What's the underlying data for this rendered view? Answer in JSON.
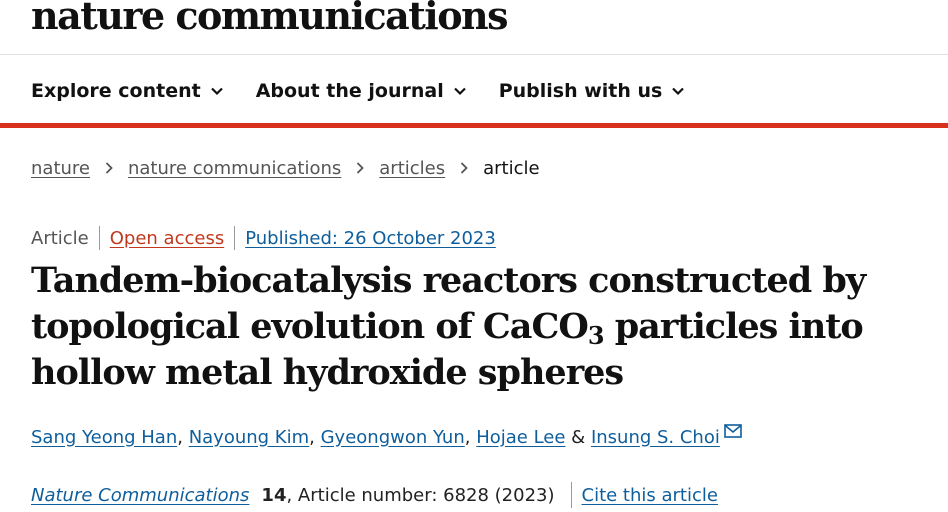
{
  "brand": {
    "name": "nature communications"
  },
  "nav": {
    "items": [
      {
        "label": "Explore content"
      },
      {
        "label": "About the journal"
      },
      {
        "label": "Publish with us"
      }
    ]
  },
  "breadcrumb": {
    "items": [
      "nature",
      "nature communications",
      "articles"
    ],
    "current": "article"
  },
  "meta": {
    "type": "Article",
    "access": "Open access",
    "published": "Published: 26 October 2023"
  },
  "title": {
    "part1": "Tandem-biocatalysis reactors constructed by topological evolution of CaCO",
    "subscript": "3",
    "part2": " particles into hollow metal hydroxide spheres"
  },
  "authors": {
    "list": [
      "Sang Yeong Han",
      "Nayoung Kim",
      "Gyeongwon Yun",
      "Hojae Lee",
      "Insung S. Choi"
    ],
    "separator": ", ",
    "last_separator": " & "
  },
  "citation": {
    "journal": "Nature Communications",
    "volume": "14",
    "article_info": ", Article number: 6828 (2023)",
    "cite_label": "Cite this article"
  },
  "colors": {
    "accent_red": "#d9301e",
    "link_blue": "#0f5e9c",
    "open_access": "#c0391f"
  },
  "icons": {
    "nav_chevron": "chevron-down-icon",
    "breadcrumb_separator": "chevron-right-icon",
    "corresponding_author": "mail-icon"
  }
}
